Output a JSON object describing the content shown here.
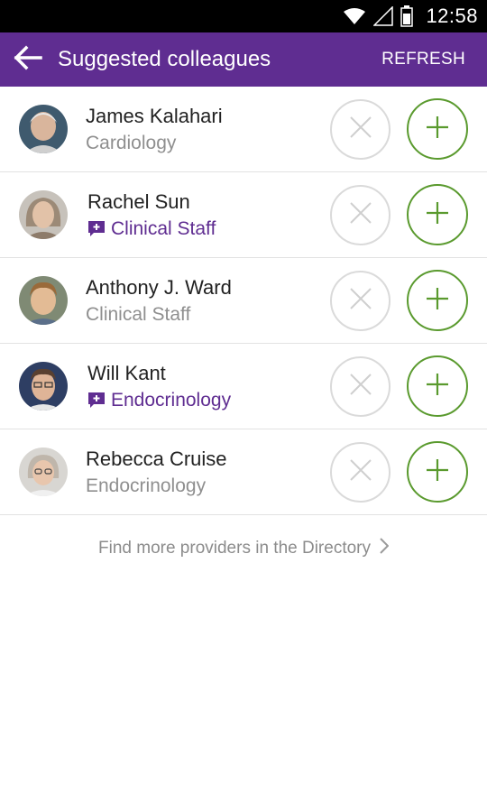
{
  "status_bar": {
    "time": "12:58",
    "icons": [
      "wifi-icon",
      "signal-icon",
      "battery-icon"
    ]
  },
  "app_bar": {
    "title": "Suggested colleagues",
    "refresh_label": "REFRESH",
    "back_icon": "arrow-left-icon",
    "color": "#5f2d91"
  },
  "colleagues": [
    {
      "name": "James Kalahari",
      "department": "Cardiology",
      "has_message_badge": false
    },
    {
      "name": "Rachel Sun",
      "department": "Clinical Staff",
      "has_message_badge": true
    },
    {
      "name": "Anthony J. Ward",
      "department": "Clinical Staff",
      "has_message_badge": false
    },
    {
      "name": "Will Kant",
      "department": "Endocrinology",
      "has_message_badge": true
    },
    {
      "name": "Rebecca Cruise",
      "department": "Endocrinology",
      "has_message_badge": false
    }
  ],
  "directory_link": {
    "label": "Find more providers in the Directory",
    "icon": "chevron-right-icon"
  },
  "colors": {
    "accent": "#5f2d91",
    "add": "#5a9a2e",
    "dismiss": "#cfcfcf"
  }
}
